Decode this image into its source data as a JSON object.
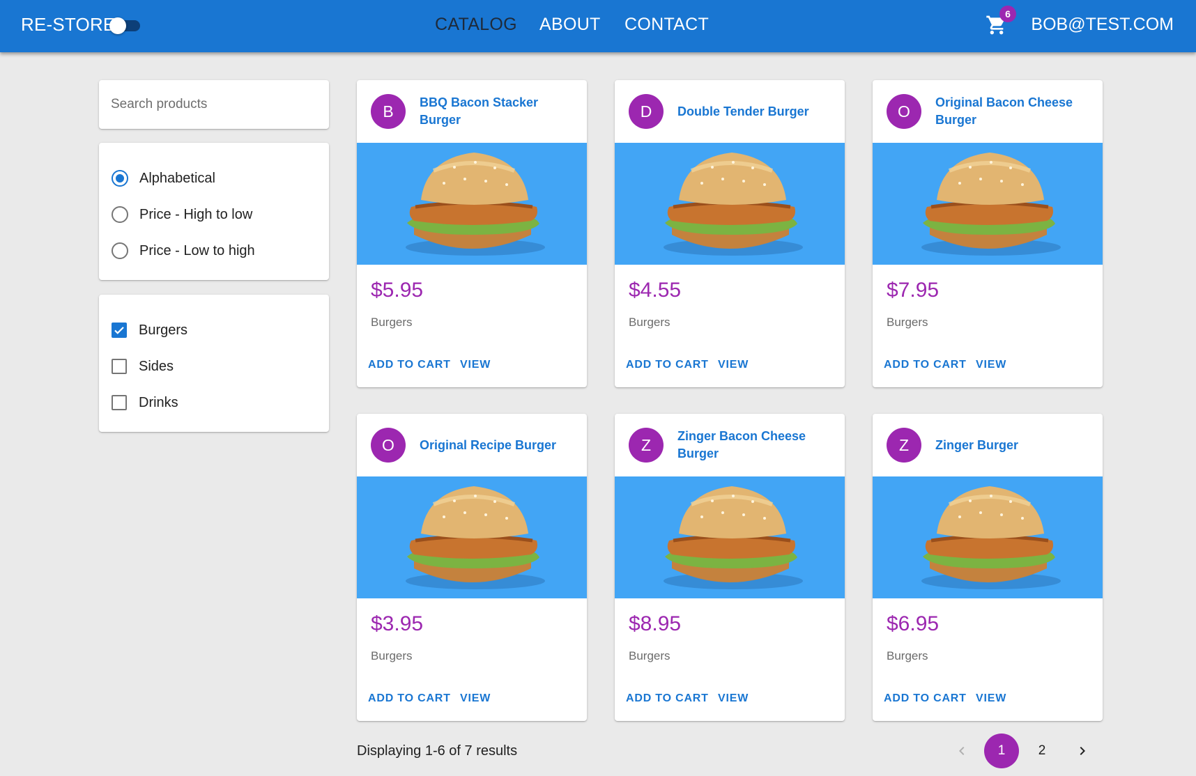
{
  "appbar": {
    "brand": "RE-STORE",
    "nav": [
      "CATALOG",
      "ABOUT",
      "CONTACT"
    ],
    "cart_count": "6",
    "user": "BOB@TEST.COM"
  },
  "search": {
    "placeholder": "Search products"
  },
  "sort_options": [
    {
      "label": "Alphabetical",
      "selected": true
    },
    {
      "label": "Price - High to low",
      "selected": false
    },
    {
      "label": "Price - Low to high",
      "selected": false
    }
  ],
  "type_filters": [
    {
      "label": "Burgers",
      "checked": true
    },
    {
      "label": "Sides",
      "checked": false
    },
    {
      "label": "Drinks",
      "checked": false
    }
  ],
  "products": [
    {
      "initial": "B",
      "name": "BBQ Bacon Stacker Burger",
      "price": "$5.95",
      "brand": "Burgers"
    },
    {
      "initial": "D",
      "name": "Double Tender Burger",
      "price": "$4.55",
      "brand": "Burgers"
    },
    {
      "initial": "O",
      "name": "Original Bacon Cheese Burger",
      "price": "$7.95",
      "brand": "Burgers"
    },
    {
      "initial": "O",
      "name": "Original Recipe Burger",
      "price": "$3.95",
      "brand": "Burgers"
    },
    {
      "initial": "Z",
      "name": "Zinger Bacon Cheese Burger",
      "price": "$8.95",
      "brand": "Burgers"
    },
    {
      "initial": "Z",
      "name": "Zinger Burger",
      "price": "$6.95",
      "brand": "Burgers"
    }
  ],
  "card_actions": {
    "add": "ADD TO CART",
    "view": "VIEW"
  },
  "results_text": "Displaying 1-6 of 7 results",
  "pagination": {
    "pages": [
      "1",
      "2"
    ],
    "current": "1"
  },
  "colors": {
    "primary": "#1976d2",
    "secondary": "#9c27b0",
    "media_bg": "#42a5f5",
    "background": "#eaeaea"
  },
  "icons": {
    "cart": "shopping-cart-icon",
    "prev": "chevron-left-icon",
    "next": "chevron-right-icon"
  }
}
